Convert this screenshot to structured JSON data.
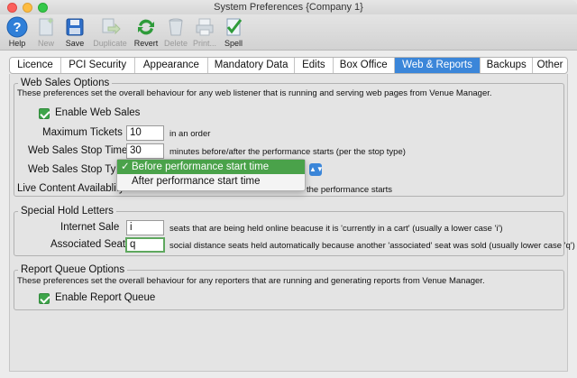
{
  "window": {
    "title": "System Preferences {Company 1}"
  },
  "toolbar": {
    "buttons": [
      {
        "label": "Help",
        "icon": "help-icon",
        "enabled": true
      },
      {
        "label": "New",
        "icon": "new-document-icon",
        "enabled": false
      },
      {
        "label": "Save",
        "icon": "save-icon",
        "enabled": true
      },
      {
        "label": "Duplicate",
        "icon": "duplicate-icon",
        "enabled": false
      },
      {
        "label": "Revert",
        "icon": "revert-icon",
        "enabled": true
      },
      {
        "label": "Delete",
        "icon": "trash-icon",
        "enabled": false
      },
      {
        "label": "Print...",
        "icon": "printer-icon",
        "enabled": false
      },
      {
        "label": "Spell",
        "icon": "spell-check-icon",
        "enabled": true
      }
    ]
  },
  "tabs": [
    {
      "label": "Licence"
    },
    {
      "label": "PCI Security"
    },
    {
      "label": "Appearance"
    },
    {
      "label": "Mandatory Data"
    },
    {
      "label": "Edits"
    },
    {
      "label": "Box Office"
    },
    {
      "label": "Web & Reports",
      "active": true
    },
    {
      "label": "Backups"
    },
    {
      "label": "Other"
    }
  ],
  "web_sales": {
    "title": "Web Sales Options",
    "description": "These preferences set the overall behaviour for any web listener that is running and serving web pages from Venue Manager.",
    "enable_label": "Enable Web Sales",
    "max_tickets_label": "Maximum Tickets",
    "max_tickets_value": "10",
    "max_tickets_suffix": "in an order",
    "stop_time_label": "Web Sales Stop Time",
    "stop_time_value": "30",
    "stop_time_suffix": "minutes before/after the performance starts (per the stop type)",
    "stop_type_label": "Web Sales Stop Type",
    "stop_type_options": [
      "Before performance start time",
      "After performance start time"
    ],
    "stop_type_selected": "Before performance start time",
    "live_content_label": "Live Content Availablity",
    "live_content_suffix": "the performance starts"
  },
  "special_hold": {
    "title": "Special Hold Letters",
    "internet_sale_label": "Internet Sale",
    "internet_sale_value": "i",
    "internet_sale_desc": "seats that are being held online beacuse it is 'currently in a cart'  (usually a lower case 'i')",
    "associated_seat_label": "Associated Seat",
    "associated_seat_value": "q",
    "associated_seat_desc": "social distance seats held automatically because another 'associated' seat was sold (usually lower case 'q')"
  },
  "report_queue": {
    "title": "Report Queue Options",
    "description": "These preferences set the overall behaviour for any reporters that are running and generating reports from Venue Manager.",
    "enable_label": "Enable Report Queue"
  },
  "colors": {
    "accent_blue": "#3b86d9",
    "check_green": "#3ea54a",
    "selection_green": "#4aa24a"
  }
}
